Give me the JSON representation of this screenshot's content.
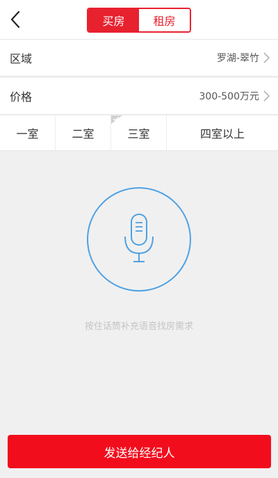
{
  "header": {
    "tabs": [
      {
        "label": "买房",
        "active": true
      },
      {
        "label": "租房",
        "active": false
      }
    ]
  },
  "filters": {
    "region": {
      "label": "区域",
      "value": "罗湖-翠竹"
    },
    "price": {
      "label": "价格",
      "value": "300-500万元"
    }
  },
  "rooms": [
    "一室",
    "二室",
    "三室",
    "四室以上"
  ],
  "voice": {
    "hint": "按住话筒补充语音找房需求"
  },
  "send_button": {
    "label": "发送给经纪人"
  },
  "colors": {
    "brand_red": "#e8212f",
    "mic_blue": "#4ea1e3"
  }
}
